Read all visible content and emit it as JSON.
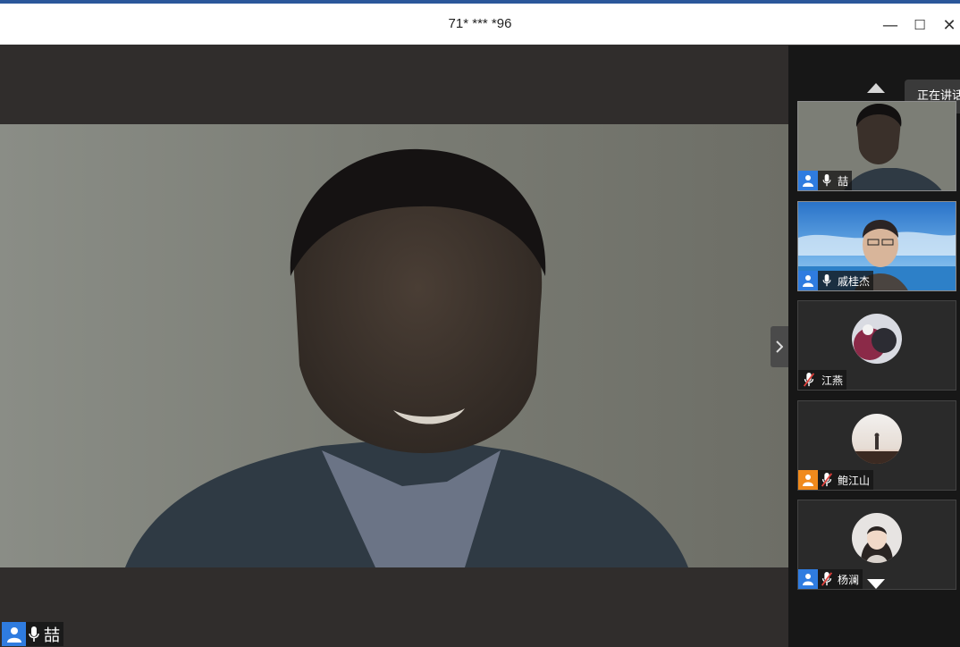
{
  "window": {
    "title": "71* *** *96",
    "minimize_glyph": "—",
    "maximize_glyph": "☐",
    "close_glyph": "✕"
  },
  "main_video": {
    "participant_name": "喆",
    "mic": "on"
  },
  "sidebar": {
    "speaking_label": "正在讲话",
    "participants": [
      {
        "name": "喆",
        "type": "video",
        "user_badge": "blue",
        "mic": "on"
      },
      {
        "name": "戚桂杰",
        "type": "video",
        "user_badge": "blue",
        "mic": "on"
      },
      {
        "name": "江燕",
        "type": "avatar",
        "user_badge": "none",
        "mic": "muted"
      },
      {
        "name": "鲍江山",
        "type": "avatar",
        "user_badge": "orange",
        "mic": "muted"
      },
      {
        "name": "杨澜",
        "type": "avatar",
        "user_badge": "blue",
        "mic": "muted"
      }
    ]
  },
  "colors": {
    "accent": "#2f7ce0",
    "host_badge": "#f08a1c",
    "muted": "#e0413c"
  }
}
